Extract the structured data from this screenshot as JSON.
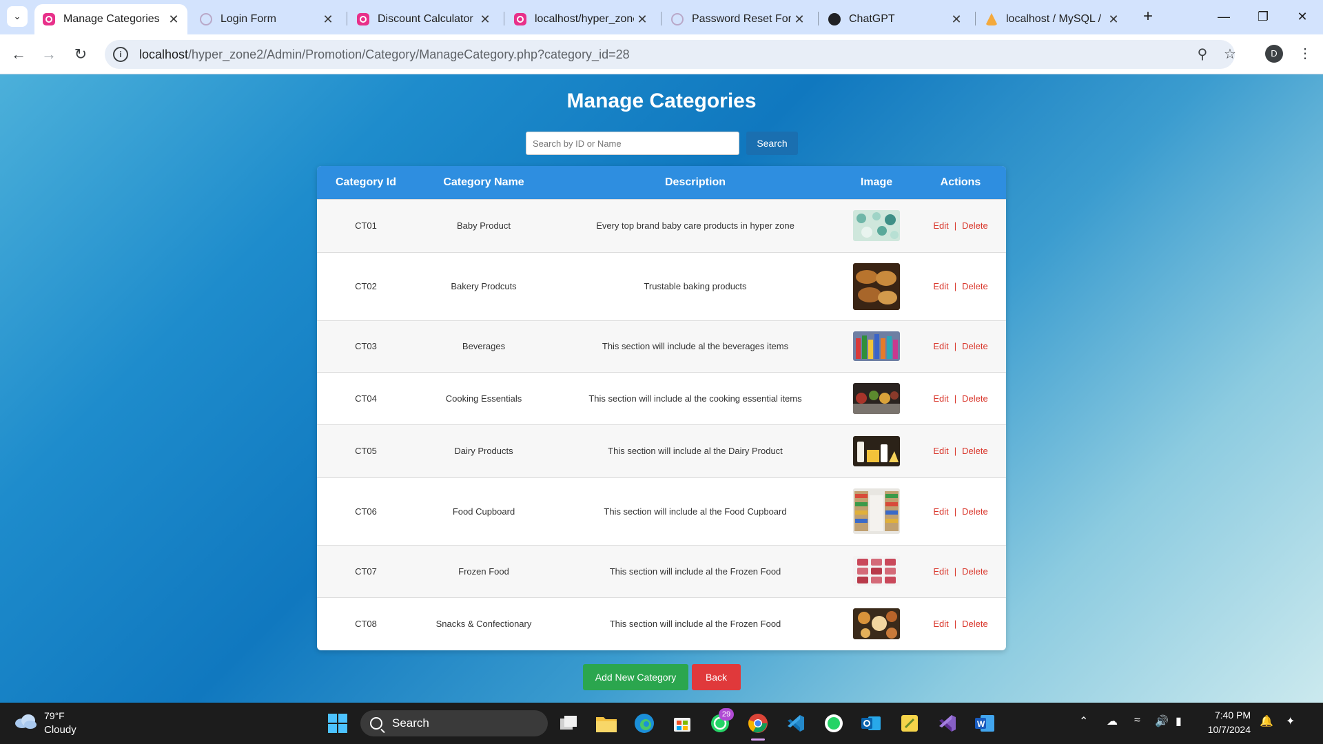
{
  "browser": {
    "tabs": [
      {
        "title": "Manage Categories",
        "favicon": "pink-app-icon",
        "active": true
      },
      {
        "title": "Login Form",
        "favicon": "loading-icon",
        "active": false
      },
      {
        "title": "Discount Calculator",
        "favicon": "pink-app-icon",
        "active": false
      },
      {
        "title": "localhost/hyper_zone",
        "favicon": "pink-app-icon",
        "active": false
      },
      {
        "title": "Password Reset Form",
        "favicon": "loading-icon",
        "active": false
      },
      {
        "title": "ChatGPT",
        "favicon": "chatgpt-icon",
        "active": false
      },
      {
        "title": "localhost / MySQL /",
        "favicon": "phpmyadmin-icon",
        "active": false
      }
    ],
    "address": {
      "host": "localhost",
      "path": "/hyper_zone2/Admin/Promotion/Category/ManageCategory.php?category_id=28"
    },
    "profile_initial": "D"
  },
  "page": {
    "title": "Manage Categories",
    "search": {
      "placeholder": "Search by ID or Name",
      "value": "",
      "button_label": "Search"
    },
    "table": {
      "columns": [
        "Category Id",
        "Category Name",
        "Description",
        "Image",
        "Actions"
      ],
      "rows": [
        {
          "id": "CT01",
          "name": "Baby Product",
          "description": "Every top brand baby care products in hyper zone",
          "image": "baby-products-photo"
        },
        {
          "id": "CT02",
          "name": "Bakery Prodcuts",
          "description": "Trustable baking products",
          "image": "bread-photo"
        },
        {
          "id": "CT03",
          "name": "Beverages",
          "description": "This section will include al the beverages items",
          "image": "beverages-photo"
        },
        {
          "id": "CT04",
          "name": "Cooking Essentials",
          "description": "This section will include al the cooking essential items",
          "image": "cooking-essentials-photo"
        },
        {
          "id": "CT05",
          "name": "Dairy Products",
          "description": "This section will include al the Dairy Product",
          "image": "dairy-photo"
        },
        {
          "id": "CT06",
          "name": "Food Cupboard",
          "description": "This section will include al the Food Cupboard",
          "image": "food-cupboard-photo"
        },
        {
          "id": "CT07",
          "name": "Frozen Food",
          "description": "This section will include al the Frozen Food",
          "image": "frozen-food-photo"
        },
        {
          "id": "CT08",
          "name": "Snacks & Confectionary",
          "description": "This section will include al the Frozen Food",
          "image": "snacks-photo"
        }
      ],
      "edit_label": "Edit",
      "action_separator": "|",
      "delete_label": "Delete"
    },
    "buttons": {
      "add_label": "Add New Category",
      "back_label": "Back"
    },
    "colors": {
      "header_bg": "#2e8ee0",
      "search_button": "#1a6fb0",
      "add_button": "#2ba64e",
      "back_button": "#e0393b",
      "action_link": "#d9362b"
    }
  },
  "taskbar": {
    "weather": {
      "temp": "79°F",
      "condition": "Cloudy"
    },
    "search_label": "Search",
    "whatsapp_badge": "29",
    "clock": {
      "time": "7:40 PM",
      "date": "10/7/2024"
    }
  }
}
